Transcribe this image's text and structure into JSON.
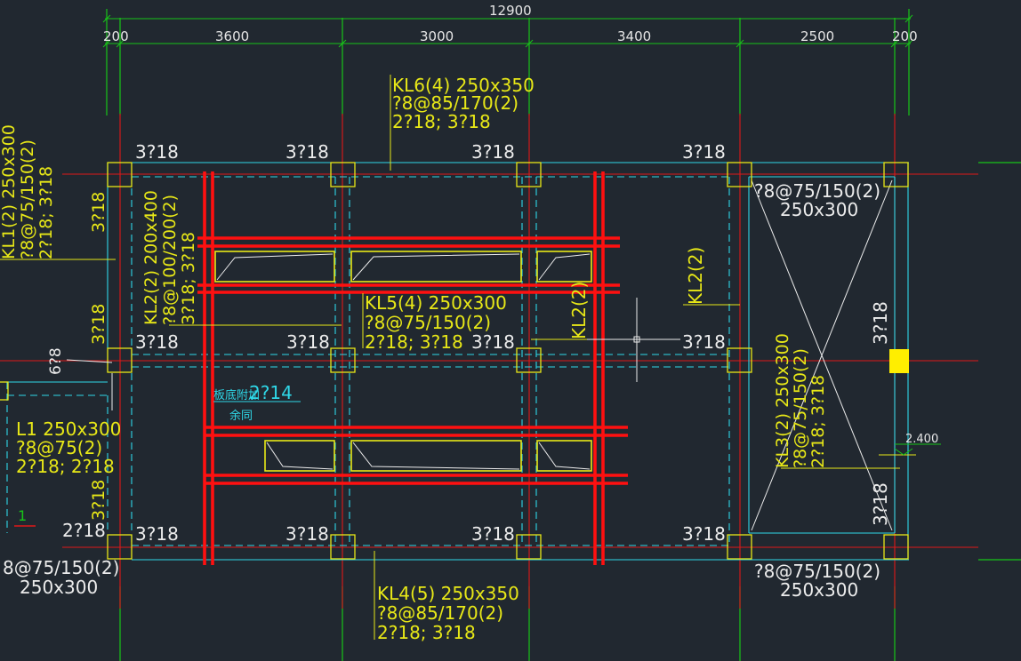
{
  "drawing": {
    "dimensions": {
      "total": "12900",
      "spans": [
        "200",
        "3600",
        "3000",
        "3400",
        "2500",
        "200"
      ]
    },
    "beams": {
      "kl6": [
        "KL6(4) 250x350",
        "?8@85/170(2)",
        "2?18; 3?18"
      ],
      "kl5": [
        "KL5(4) 250x300",
        "?8@75/150(2)",
        "2?18; 3?18"
      ],
      "kl4": [
        "KL4(5) 250x350",
        "?8@85/170(2)",
        "2?18; 3?18"
      ],
      "kl1": [
        "KL1(2) 250x300",
        "?8@75/150(2)",
        "2?18; 3?18"
      ],
      "kl2_left": [
        "KL2(2) 200x400",
        "?8@100/200(2)",
        "3?18; 3?18"
      ],
      "kl2_mid": "KL2(2)",
      "kl2_right": "KL2(2)",
      "kl3": [
        "KL3(2) 250x300",
        "?8@75/150(2)",
        "2?18; 3?18"
      ],
      "l1": [
        "L1 250x300",
        "?8@75(2)",
        "2?18; 2?18"
      ],
      "top_right": [
        "?8@75/150(2)",
        "250x300"
      ],
      "bottom_right": [
        "?8@75/150(2)",
        "250x300"
      ],
      "bottom_left": [
        "8@75/150(2)",
        "250x300"
      ]
    },
    "rebar_labels": {
      "r318": "3?18",
      "r218": "2?18",
      "r68": "6?8"
    },
    "slab_note": {
      "label": "板底附加",
      "value": "2?14",
      "sub": "余同"
    },
    "elevation": "2.400",
    "axis_mark": "1"
  },
  "colors": {
    "background": "#212830",
    "grid_line": "#18c418",
    "axis_red": "#e01818",
    "beam_cyan": "#2fd8e8",
    "text_yellow": "#e8e817",
    "rebar_red": "#ff1010",
    "highlight": "#ffee00"
  }
}
